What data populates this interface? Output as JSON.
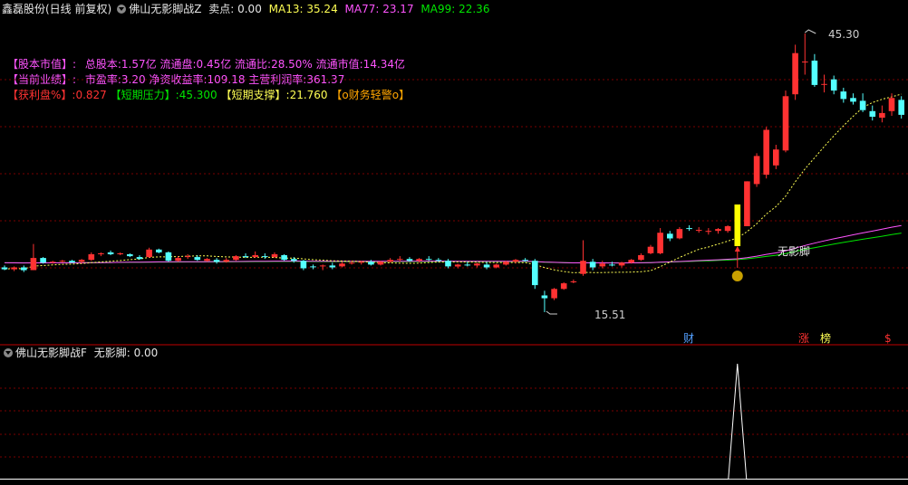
{
  "header": {
    "stock": "鑫磊股份(日线 前复权)",
    "indicator": "佛山无影脚战Z",
    "sell_label": "卖点: 0.00",
    "ma13": "MA13: 35.24",
    "ma77": "MA77: 23.17",
    "ma99": "MA99: 22.36"
  },
  "info": {
    "line1_key": "【股本市值】:",
    "line1_val": "总股本:1.57亿 流通盘:0.45亿 流通比:28.50% 流通市值:14.34亿",
    "line2_key": "【当前业绩】:",
    "line2_val": "市盈率:3.20 净资收益率:109.18 主营利润率:361.37",
    "profit_key": "【获利盘%】",
    "profit_val": ":0.827",
    "pressure_key": "【短期压力】",
    "pressure_val": ":45.300",
    "support_key": "【短期支撑】",
    "support_val": ":21.760",
    "warning": "【o财务轻警o】"
  },
  "annotations": {
    "high": "45.30",
    "low": "15.51",
    "signal": "无影脚"
  },
  "event_markers": [
    "财",
    "涨",
    "榜",
    "$"
  ],
  "sub_panel": {
    "title": "佛山无影脚战F",
    "value_label": "无影脚: 0.00"
  },
  "colors": {
    "up": "#ff3232",
    "down": "#54ffff",
    "ma13": "#ffff54",
    "ma77": "#ff54ff",
    "ma99": "#00e600",
    "signal_bar": "#ffff00",
    "grid": "#7a0000"
  },
  "chart_data": {
    "type": "candlestick",
    "price_range": [
      15.51,
      45.3
    ],
    "candles": [
      [
        20.3,
        20.5,
        20.0,
        20.1
      ],
      [
        20.1,
        20.4,
        19.9,
        20.3
      ],
      [
        20.3,
        20.5,
        19.8,
        20.0
      ],
      [
        20.0,
        22.8,
        20.0,
        21.3
      ],
      [
        21.3,
        21.4,
        20.7,
        20.8
      ],
      [
        20.8,
        21.0,
        20.7,
        20.9
      ],
      [
        20.9,
        21.1,
        20.8,
        21.0
      ],
      [
        21.0,
        21.1,
        20.8,
        20.8
      ],
      [
        20.9,
        21.2,
        20.7,
        21.1
      ],
      [
        21.1,
        21.9,
        21.0,
        21.7
      ],
      [
        21.7,
        21.9,
        21.5,
        21.8
      ],
      [
        21.9,
        22.1,
        21.6,
        21.7
      ],
      [
        21.8,
        21.9,
        21.6,
        21.8
      ],
      [
        21.7,
        21.8,
        21.4,
        21.5
      ],
      [
        21.4,
        21.6,
        21.1,
        21.2
      ],
      [
        21.4,
        22.4,
        21.3,
        22.2
      ],
      [
        22.2,
        22.3,
        21.8,
        21.9
      ],
      [
        21.9,
        22.0,
        20.9,
        21.0
      ],
      [
        21.0,
        21.5,
        20.9,
        21.3
      ],
      [
        21.4,
        21.7,
        21.2,
        21.5
      ],
      [
        21.4,
        21.6,
        21.0,
        21.1
      ],
      [
        21.0,
        21.3,
        20.9,
        21.2
      ],
      [
        21.1,
        21.3,
        20.7,
        20.9
      ],
      [
        20.9,
        21.3,
        20.8,
        21.1
      ],
      [
        21.1,
        21.6,
        21.0,
        21.5
      ],
      [
        21.5,
        21.8,
        21.3,
        21.4
      ],
      [
        21.4,
        22.0,
        21.3,
        21.6
      ],
      [
        21.5,
        21.8,
        21.2,
        21.4
      ],
      [
        21.4,
        21.9,
        21.3,
        21.7
      ],
      [
        21.6,
        21.7,
        21.0,
        21.1
      ],
      [
        21.2,
        21.4,
        20.8,
        21.0
      ],
      [
        21.0,
        21.1,
        20.0,
        20.2
      ],
      [
        20.4,
        20.6,
        20.1,
        20.3
      ],
      [
        20.4,
        20.6,
        20.0,
        20.5
      ],
      [
        20.5,
        20.8,
        20.1,
        20.3
      ],
      [
        20.4,
        20.9,
        20.3,
        20.7
      ],
      [
        20.7,
        21.0,
        20.6,
        20.8
      ],
      [
        20.8,
        21.0,
        20.6,
        20.9
      ],
      [
        20.9,
        21.1,
        20.5,
        20.6
      ],
      [
        20.6,
        21.0,
        20.5,
        20.9
      ],
      [
        20.9,
        21.3,
        20.8,
        21.1
      ],
      [
        21.1,
        21.5,
        20.9,
        21.2
      ],
      [
        21.2,
        21.4,
        20.9,
        21.0
      ],
      [
        21.0,
        21.3,
        20.8,
        21.2
      ],
      [
        21.2,
        21.5,
        21.0,
        21.1
      ],
      [
        21.1,
        21.3,
        20.9,
        21.0
      ],
      [
        21.0,
        21.2,
        20.2,
        20.4
      ],
      [
        20.4,
        20.7,
        20.2,
        20.6
      ],
      [
        20.6,
        20.9,
        20.4,
        20.5
      ],
      [
        20.5,
        20.8,
        20.3,
        20.7
      ],
      [
        20.6,
        20.9,
        20.1,
        20.3
      ],
      [
        20.3,
        20.7,
        20.2,
        20.6
      ],
      [
        20.6,
        21.0,
        20.5,
        20.9
      ],
      [
        20.9,
        21.2,
        20.7,
        21.1
      ],
      [
        21.1,
        21.3,
        20.9,
        21.0
      ],
      [
        21.0,
        21.2,
        18.0,
        18.4
      ],
      [
        17.3,
        17.8,
        15.51,
        17.0
      ],
      [
        17.0,
        18.1,
        16.8,
        18.0
      ],
      [
        18.0,
        18.7,
        17.9,
        18.6
      ],
      [
        18.8,
        19.0,
        18.6,
        18.8
      ],
      [
        19.6,
        23.2,
        19.4,
        21.0
      ],
      [
        20.9,
        21.2,
        20.0,
        20.3
      ],
      [
        20.4,
        21.0,
        20.2,
        20.7
      ],
      [
        20.6,
        20.9,
        20.4,
        20.5
      ],
      [
        20.5,
        20.9,
        20.3,
        20.8
      ],
      [
        20.8,
        21.2,
        20.7,
        21.1
      ],
      [
        21.1,
        21.8,
        21.0,
        21.6
      ],
      [
        21.8,
        22.7,
        21.7,
        22.5
      ],
      [
        21.8,
        24.5,
        21.7,
        24.0
      ],
      [
        23.9,
        24.2,
        23.1,
        23.4
      ],
      [
        23.4,
        24.6,
        23.3,
        24.4
      ],
      [
        24.5,
        24.8,
        24.2,
        24.4
      ],
      [
        24.3,
        24.6,
        24.0,
        24.3
      ],
      [
        24.1,
        24.5,
        23.8,
        24.2
      ],
      [
        24.2,
        24.5,
        23.9,
        24.4
      ],
      [
        24.2,
        24.8,
        24.0,
        24.7
      ],
      [
        24.7,
        25.2,
        24.4,
        25.0
      ],
      [
        24.7,
        29.5,
        24.7,
        29.5
      ],
      [
        29.2,
        32.5,
        28.9,
        32.2
      ],
      [
        30.2,
        35.3,
        29.8,
        35.0
      ],
      [
        31.2,
        33.4,
        30.8,
        32.9
      ],
      [
        32.8,
        39.2,
        32.6,
        38.6
      ],
      [
        38.8,
        44.1,
        38.2,
        43.2
      ],
      [
        42.2,
        45.3,
        40.9,
        42.3
      ],
      [
        42.4,
        43.1,
        39.6,
        39.8
      ],
      [
        39.8,
        40.9,
        39.0,
        39.9
      ],
      [
        40.4,
        40.8,
        38.8,
        39.2
      ],
      [
        39.1,
        39.5,
        37.9,
        38.3
      ],
      [
        38.4,
        38.9,
        37.7,
        38.0
      ],
      [
        38.1,
        38.9,
        36.9,
        37.1
      ],
      [
        37.0,
        37.6,
        36.0,
        36.4
      ],
      [
        36.3,
        37.6,
        35.8,
        36.8
      ],
      [
        37.0,
        38.9,
        36.5,
        38.4
      ],
      [
        38.2,
        38.6,
        36.2,
        36.6
      ]
    ]
  }
}
